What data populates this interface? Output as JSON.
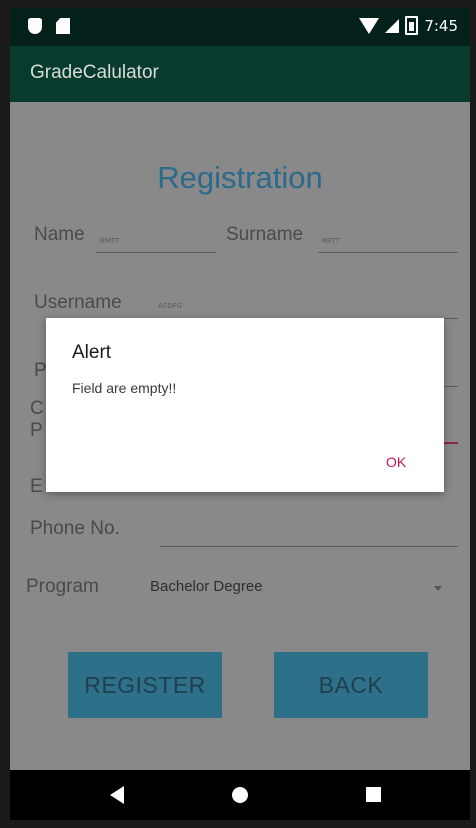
{
  "status_bar": {
    "time": "7:45"
  },
  "app_bar": {
    "title": "GradeCalulator"
  },
  "form": {
    "heading": "Registration",
    "name_label": "Name",
    "name_value": "RMTT",
    "surname_label": "Surname",
    "surname_value": "RRTT",
    "username_label": "Username",
    "username_value": "ASDFG",
    "password_label_partial": "P",
    "confirm_label_partial_1": "C",
    "confirm_label_partial_2": "P",
    "email_label_partial": "E",
    "phone_label": "Phone No.",
    "program_label": "Program",
    "program_value": "Bachelor Degree",
    "register_button": "REGISTER",
    "back_button": "BACK"
  },
  "dialog": {
    "title": "Alert",
    "message": "Field are empty!!",
    "ok_button": "OK"
  },
  "colors": {
    "status_bar_bg": "#03211a",
    "app_bar_bg": "#063b2e",
    "heading": "#2b6a8a",
    "button_bg": "#2e6f8a",
    "ok_accent": "#c4165a"
  },
  "icons": [
    "shield-icon",
    "sdcard-icon",
    "wifi-icon",
    "signal-icon",
    "battery-icon",
    "back-nav-icon",
    "home-nav-icon",
    "recents-nav-icon",
    "dropdown-caret-icon"
  ]
}
